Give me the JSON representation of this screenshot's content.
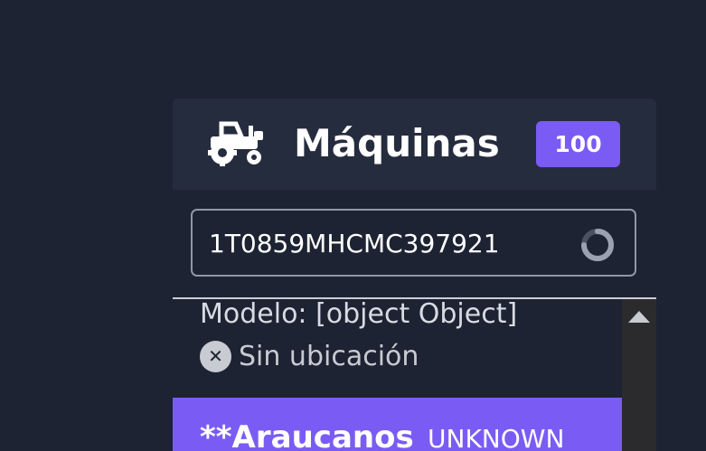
{
  "header": {
    "title": "Máquinas",
    "count": "100",
    "icon": "tractor-icon"
  },
  "search": {
    "value": "1T0859MHCMC397921",
    "status_icon": "loading-spinner-icon"
  },
  "results": {
    "model_line": "Modelo: [object Object]",
    "location": "Sin ubicación",
    "location_icon": "close-circle-icon",
    "selected": {
      "name": "**Araucanos",
      "status": "UNKNOWN"
    }
  },
  "colors": {
    "background": "#1d2333",
    "accent": "#7a5cf4"
  }
}
